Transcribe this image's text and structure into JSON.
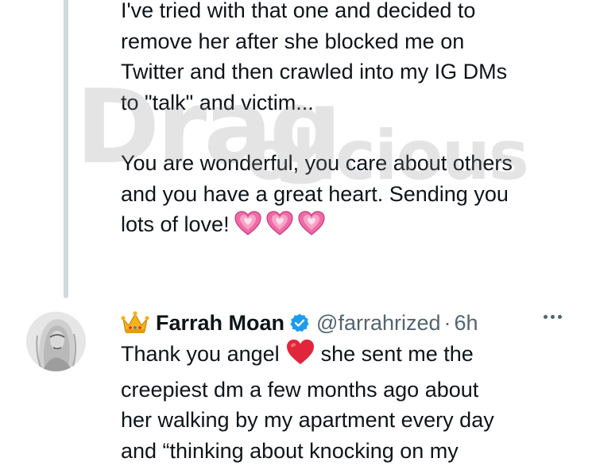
{
  "previous_tweet": {
    "lines": [
      "I've tried with that one and decided to",
      "remove her after she blocked me on",
      "Twitter and then crawled into my IG DMs",
      "to \"talk\" and victim..."
    ],
    "lines2": [
      "You are wonderful, you care about others",
      "and you have a great heart. Sending you",
      "lots of love!"
    ],
    "emoji": "sparkling-heart x3"
  },
  "watermark": {
    "text_big": "Drag",
    "text_small": "olicious"
  },
  "reply": {
    "name": "Farrah Moan",
    "handle": "@farrahrized",
    "separator": "·",
    "time": "6h",
    "lines": [
      "Thank you angel",
      "she sent me the",
      "creepiest dm a few months ago about",
      "her walking by my apartment every day",
      "and “thinking about knocking on my"
    ]
  },
  "colors": {
    "text": "#0f1419",
    "secondary": "#536471",
    "verified": "#1d9bf0",
    "thread_line": "#cfd9de",
    "heart_pink": "#f06ba5",
    "heart_red": "#e0263a"
  }
}
